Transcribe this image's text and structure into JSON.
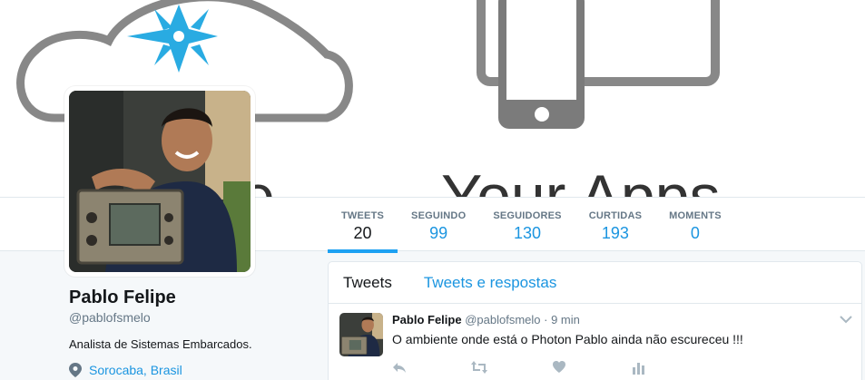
{
  "profile": {
    "name": "Pablo Felipe",
    "handle": "@pablofsmelo",
    "bio": "Analista de Sistemas Embarcados.",
    "location": "Sorocaba, Brasil"
  },
  "banner": {
    "partial_text_left": "le",
    "partial_text_right": "Your Apps"
  },
  "stats": [
    {
      "label": "TWEETS",
      "value": "20"
    },
    {
      "label": "SEGUINDO",
      "value": "99"
    },
    {
      "label": "SEGUIDORES",
      "value": "130"
    },
    {
      "label": "CURTIDAS",
      "value": "193"
    },
    {
      "label": "MOMENTS",
      "value": "0"
    }
  ],
  "timeline": {
    "tabs": [
      "Tweets",
      "Tweets e respostas"
    ]
  },
  "tweet": {
    "name": "Pablo Felipe",
    "handle": "@pablofsmelo",
    "separator": "·",
    "time": "9 min",
    "text": "O ambiente onde está o Photon Pablo ainda não escureceu !!!"
  },
  "icons": {
    "location": "map-pin-icon",
    "reply": "reply-icon",
    "retweet": "retweet-icon",
    "like": "heart-icon",
    "analytics": "analytics-icon",
    "more": "chevron-down-icon"
  },
  "colors": {
    "accent": "#1da1f2",
    "link": "#1b95e0",
    "star": "#29abe2",
    "text": "#14171a",
    "muted": "#657786"
  }
}
